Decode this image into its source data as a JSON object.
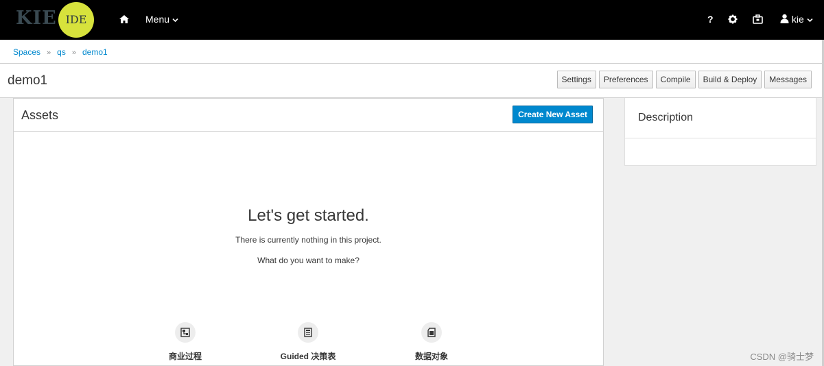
{
  "navbar": {
    "logo_text": "KIE",
    "logo_badge": "IDE",
    "menu_label": "Menu",
    "help_label": "?",
    "user_label": "kie"
  },
  "breadcrumb": [
    "Spaces",
    "qs",
    "demo1"
  ],
  "page": {
    "title": "demo1",
    "toolbar": [
      "Settings",
      "Preferences",
      "Compile",
      "Build & Deploy",
      "Messages"
    ]
  },
  "assets": {
    "title": "Assets",
    "create_label": "Create New Asset",
    "empty_title": "Let's get started.",
    "empty_line1": "There is currently nothing in this project.",
    "empty_line2": "What do you want to make?",
    "types": [
      "商业过程",
      "Guided 决策表",
      "数据对象"
    ]
  },
  "description": {
    "title": "Description"
  },
  "watermark": "CSDN @骑士梦",
  "colors": {
    "navbar": "#000000",
    "link": "#0088ce",
    "primary": "#0088ce",
    "logo_badge": "#d7e23c"
  }
}
